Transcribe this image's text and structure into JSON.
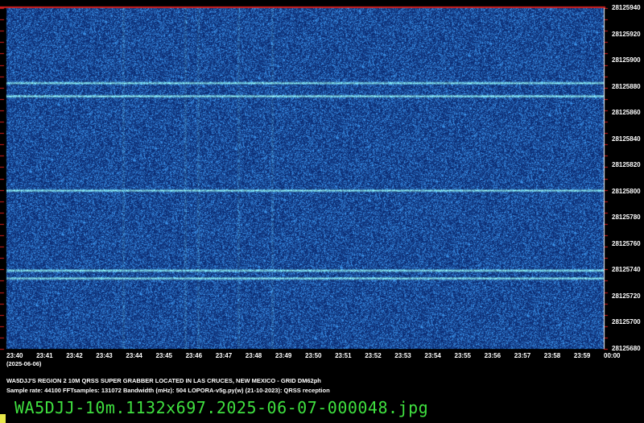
{
  "waterfall": {
    "y_axis_labels": [
      "28125940",
      "28125920",
      "28125900",
      "28125880",
      "28125860",
      "28125840",
      "28125820",
      "28125800",
      "28125780",
      "28125760",
      "28125740",
      "28125720",
      "28125700",
      "28125680"
    ],
    "x_axis_labels": [
      "23:40",
      "23:41",
      "23:42",
      "23:43",
      "23:44",
      "23:45",
      "23:46",
      "23:47",
      "23:48",
      "23:49",
      "23:50",
      "23:51",
      "23:52",
      "23:53",
      "23:54",
      "23:55",
      "23:56",
      "23:57",
      "23:58",
      "23:59",
      "00:00"
    ],
    "date_label": "(2025-06-06)",
    "signal_frequencies": [
      28125883,
      28125873,
      28125801,
      28125740,
      28125734
    ],
    "colors": {
      "background": "#0b2a6e",
      "noise_bright": "#2f7fd8",
      "signal": "#9fe4ff",
      "top_marker": "#d21e1e",
      "tick": "#d21e1e",
      "filename": "#3fe03f",
      "cursor": "#e8e84a"
    }
  },
  "info": {
    "title": "WA5DJJ'S REGION 2 10M QRSS SUPER GRABBER LOCATED IN LAS CRUCES, NEW MEXICO - GRID DM62ph",
    "params": "Sample rate: 44100     FFTsamples: 131072     Bandwidth (mHz): 504          LOPORA-v5g.py(w) (21-10-2023): QRSS reception"
  },
  "filename": "WA5DJJ-10m.1132x697.2025-06-07-000048.jpg"
}
